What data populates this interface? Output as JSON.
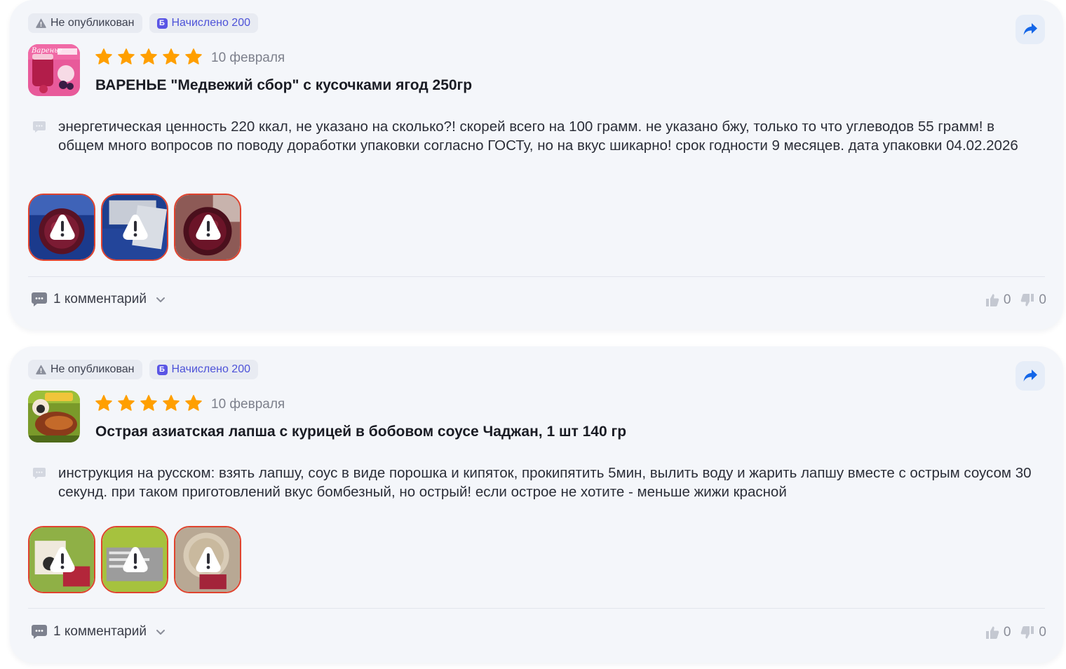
{
  "reviews": [
    {
      "status_badge": "Не опубликован",
      "points_badge": "Начислено 200",
      "points_icon": "Б",
      "rating": 5,
      "date": "10 февраля",
      "product_title": "ВАРЕНЬЕ \"Медвежий сбор\" с кусочками ягод 250гр",
      "product_image_caption": "Варенье",
      "text": "энергетическая ценность 220 ккал, не указано на сколько?! скорей всего на 100 грамм. не указано бжу, только то что углеводов 55 грамм! в общем много вопросов по поводу доработки упаковки согласно ГОСТу, но на вкус шикарно! срок годности 9 месяцев. дата упаковки 04.02.2026",
      "photos_count": 3,
      "comments_label": "1 комментарий",
      "likes": "0",
      "dislikes": "0"
    },
    {
      "status_badge": "Не опубликован",
      "points_badge": "Начислено 200",
      "points_icon": "Б",
      "rating": 5,
      "date": "10 февраля",
      "product_title": "Острая азиатская лапша с курицей в бобовом соусе Чаджан, 1 шт 140 гр",
      "text": "инструкция на русском: взять лапшу, соус в виде порошка и кипяток, прокипятить 5мин, вылить воду и жарить лапшу вместе с острым соусом 30 секунд. при таком приготовлений вкус бомбезный, но острый! если острое не хотите - меньше жижи красной",
      "photos_count": 3,
      "comments_label": "1 комментарий",
      "likes": "0",
      "dislikes": "0"
    }
  ],
  "colors": {
    "star": "#ff9f00",
    "photo_border": "#e0432e",
    "share_arrow": "#1466e8",
    "points_accent": "#5a55e5"
  }
}
